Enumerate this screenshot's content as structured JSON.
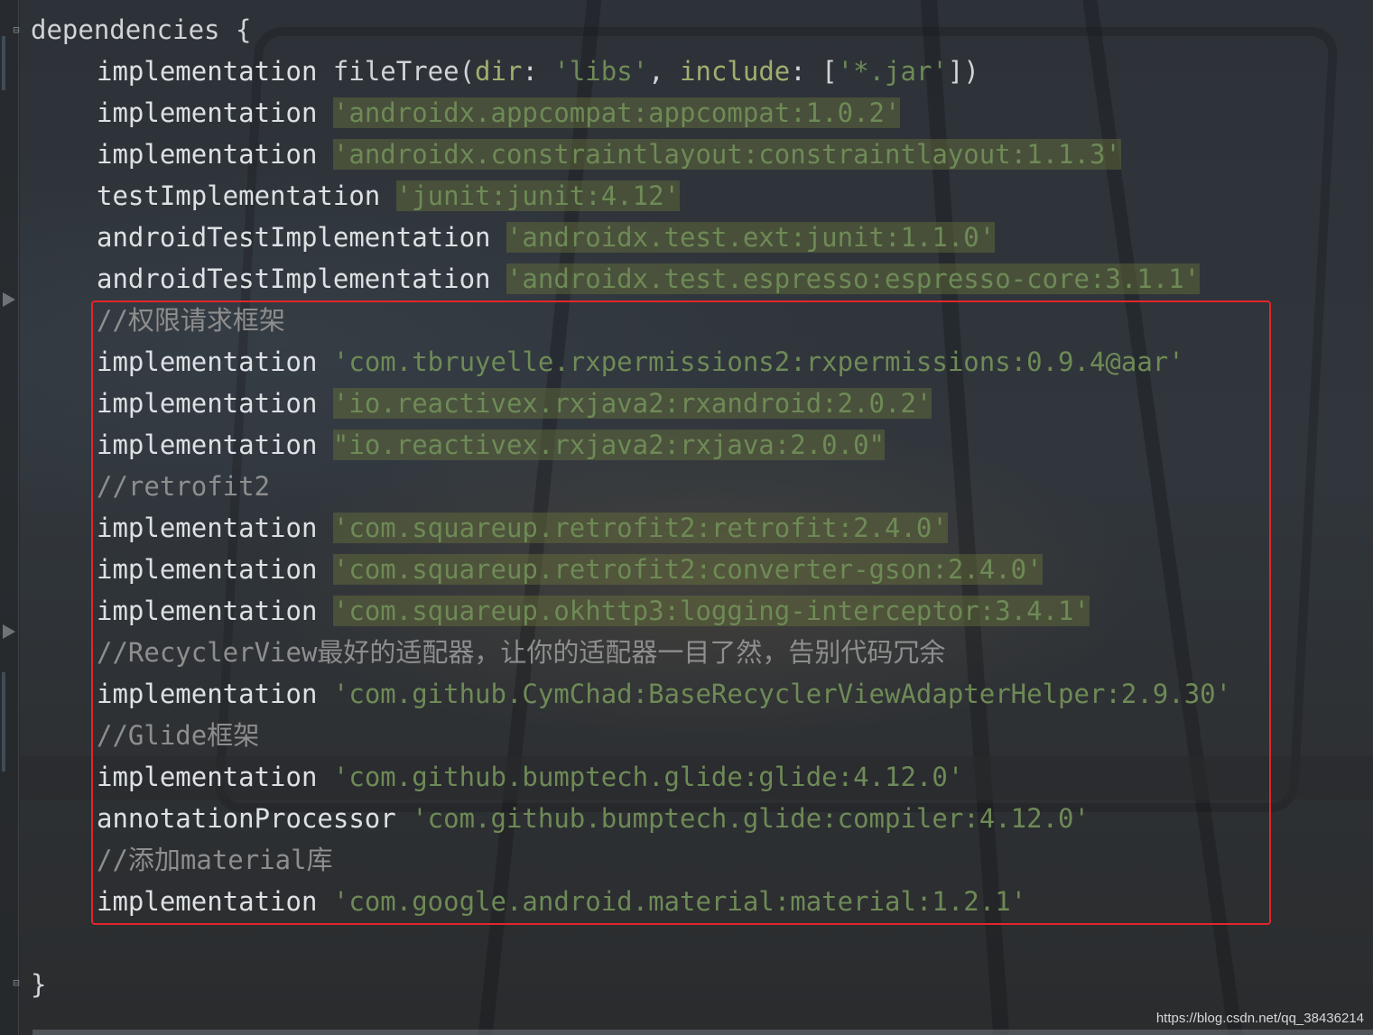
{
  "editor": {
    "lines": [
      {
        "indent": 0,
        "segments": [
          {
            "t": "dependencies {",
            "c": "plain"
          }
        ]
      },
      {
        "indent": 1,
        "segments": [
          {
            "t": "implementation ",
            "c": "kw"
          },
          {
            "t": "fileTree(",
            "c": "plain"
          },
          {
            "t": "dir",
            "c": "param"
          },
          {
            "t": ": ",
            "c": "plain"
          },
          {
            "t": "'libs'",
            "c": "str"
          },
          {
            "t": ", ",
            "c": "plain"
          },
          {
            "t": "include",
            "c": "param"
          },
          {
            "t": ": [",
            "c": "plain"
          },
          {
            "t": "'*.jar'",
            "c": "str"
          },
          {
            "t": "])",
            "c": "plain"
          }
        ]
      },
      {
        "indent": 1,
        "segments": [
          {
            "t": "implementation ",
            "c": "kw"
          },
          {
            "t": "'androidx.appcompat:appcompat:1.0.2'",
            "c": "str hl"
          }
        ]
      },
      {
        "indent": 1,
        "segments": [
          {
            "t": "implementation ",
            "c": "kw"
          },
          {
            "t": "'androidx.constraintlayout:constraintlayout:1.1.3'",
            "c": "str hl"
          }
        ]
      },
      {
        "indent": 1,
        "segments": [
          {
            "t": "testImplementation ",
            "c": "kw"
          },
          {
            "t": "'junit:junit:4.12'",
            "c": "str hl"
          }
        ]
      },
      {
        "indent": 1,
        "segments": [
          {
            "t": "androidTestImplementation ",
            "c": "kw"
          },
          {
            "t": "'androidx.test.ext:junit:1.1.0'",
            "c": "str hl"
          }
        ]
      },
      {
        "indent": 1,
        "segments": [
          {
            "t": "androidTestImplementation ",
            "c": "kw"
          },
          {
            "t": "'androidx.test.espresso:espresso-core:3.1.1'",
            "c": "str hl"
          }
        ]
      },
      {
        "indent": 1,
        "segments": [
          {
            "t": "//权限请求框架",
            "c": "cm"
          }
        ]
      },
      {
        "indent": 1,
        "segments": [
          {
            "t": "implementation ",
            "c": "kw"
          },
          {
            "t": "'com.tbruyelle.rxpermissions2:rxpermissions:0.9.4@aar'",
            "c": "str"
          }
        ]
      },
      {
        "indent": 1,
        "segments": [
          {
            "t": "implementation ",
            "c": "kw"
          },
          {
            "t": "'io.reactivex.rxjava2:rxandroid:2.0.2'",
            "c": "str hl"
          }
        ]
      },
      {
        "indent": 1,
        "segments": [
          {
            "t": "implementation ",
            "c": "kw"
          },
          {
            "t": "\"io.reactivex.rxjava2:rxjava:2.0.0\"",
            "c": "str hl"
          }
        ]
      },
      {
        "indent": 1,
        "segments": [
          {
            "t": "//retrofit2",
            "c": "cm"
          }
        ]
      },
      {
        "indent": 1,
        "segments": [
          {
            "t": "implementation ",
            "c": "kw"
          },
          {
            "t": "'com.squareup.retrofit2:retrofit:2.4.0'",
            "c": "str hl"
          }
        ]
      },
      {
        "indent": 1,
        "segments": [
          {
            "t": "implementation ",
            "c": "kw"
          },
          {
            "t": "'com.squareup.retrofit2:converter-gson:2.4.0'",
            "c": "str hl"
          }
        ]
      },
      {
        "indent": 1,
        "segments": [
          {
            "t": "implementation ",
            "c": "kw"
          },
          {
            "t": "'com.squareup.okhttp3:logging-interceptor:3.4.1'",
            "c": "str hl"
          }
        ]
      },
      {
        "indent": 1,
        "segments": [
          {
            "t": "//RecyclerView最好的适配器，让你的适配器一目了然，告别代码冗余",
            "c": "cm"
          }
        ]
      },
      {
        "indent": 1,
        "segments": [
          {
            "t": "implementation ",
            "c": "kw"
          },
          {
            "t": "'com.github.CymChad:BaseRecyclerViewAdapterHelper:2.9.30'",
            "c": "str"
          }
        ]
      },
      {
        "indent": 1,
        "segments": [
          {
            "t": "//Glide框架",
            "c": "cm"
          }
        ]
      },
      {
        "indent": 1,
        "segments": [
          {
            "t": "implementation ",
            "c": "kw"
          },
          {
            "t": "'com.github.bumptech.glide:glide:4.12.0'",
            "c": "str"
          }
        ]
      },
      {
        "indent": 1,
        "segments": [
          {
            "t": "annotationProcessor ",
            "c": "kw"
          },
          {
            "t": "'com.github.bumptech.glide:compiler:4.12.0'",
            "c": "str"
          }
        ]
      },
      {
        "indent": 1,
        "segments": [
          {
            "t": "//添加material库",
            "c": "cm"
          }
        ]
      },
      {
        "indent": 1,
        "segments": [
          {
            "t": "implementation ",
            "c": "kw"
          },
          {
            "t": "'com.google.android.material:material:1.2.1'",
            "c": "str"
          }
        ]
      },
      {
        "indent": 0,
        "segments": [
          {
            "t": "",
            "c": "plain"
          }
        ]
      },
      {
        "indent": 0,
        "segments": [
          {
            "t": "}",
            "c": "plain"
          }
        ]
      }
    ]
  },
  "watermark": "https://blog.csdn.net/qq_38436214"
}
